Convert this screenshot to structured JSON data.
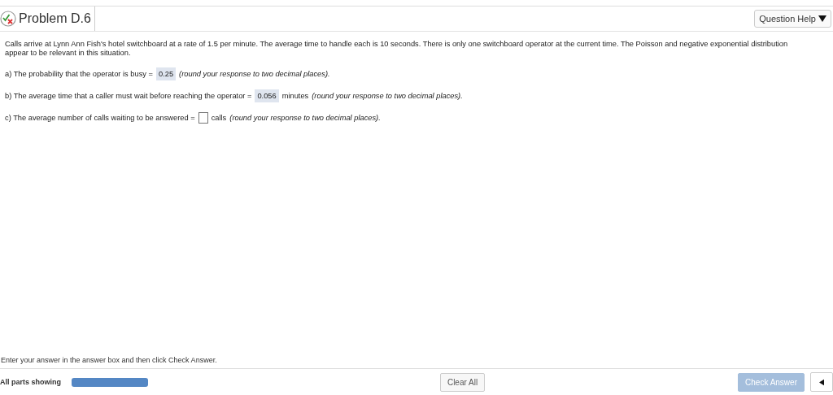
{
  "header": {
    "title": "Problem D.6",
    "help_button": "Question Help"
  },
  "problem": {
    "lines": [
      "Calls arrive at Lynn Ann Fish's hotel switchboard at a rate of 1.5 per minute. The average time to handle each is 10 seconds.  There is only one switchboard operator at the current time. The Poisson and negative exponential distribution",
      "appear to be relevant in this situation."
    ]
  },
  "parts": [
    {
      "prompt": "a) The probability that the operator is busy =",
      "value": "0.25",
      "hint": "(round your response to two decimal places)."
    },
    {
      "prompt": "b) The average time that a caller must wait before reaching the operator =",
      "value": "0.056",
      "unit": "minutes",
      "hint": "(round your response to two decimal places)."
    },
    {
      "prompt": "c) The average number of calls waiting to be answered =",
      "unit": "calls",
      "hint": "(round your response to two decimal places)."
    }
  ],
  "instruction": "Enter your answer in the answer box and then click Check Answer.",
  "footer": {
    "parts_label": "All parts showing",
    "progress": {
      "level": 1
    },
    "clear_button": "Clear All",
    "check_button": {
      "label": "Check Answer",
      "disabled": true
    }
  }
}
